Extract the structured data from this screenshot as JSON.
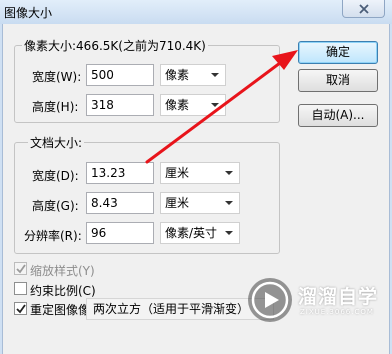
{
  "window": {
    "title": "图像大小"
  },
  "pixel_dimensions": {
    "legend": "像素大小:466.5K(之前为710.4K)",
    "width_label": "宽度(W):",
    "width_value": "500",
    "width_unit": "像素",
    "height_label": "高度(H):",
    "height_value": "318",
    "height_unit": "像素"
  },
  "document_size": {
    "legend": "文档大小:",
    "width_label": "宽度(D):",
    "width_value": "13.23",
    "width_unit": "厘米",
    "height_label": "高度(G):",
    "height_value": "8.43",
    "height_unit": "厘米",
    "resolution_label": "分辨率(R):",
    "resolution_value": "96",
    "resolution_unit": "像素/英寸"
  },
  "buttons": {
    "ok": "确定",
    "cancel": "取消",
    "auto": "自动(A)..."
  },
  "options": {
    "scale_styles": {
      "label": "缩放样式(Y)",
      "checked": true,
      "disabled": true
    },
    "constrain_proportions": {
      "label": "约束比例(C)",
      "checked": false
    },
    "resample": {
      "label": "重定图像像素(I):",
      "checked": true,
      "method": "两次立方（适用于平滑渐变）"
    }
  },
  "watermark": {
    "brand": "溜溜自学",
    "url": "ZIXUE.3066.COM"
  },
  "colors": {
    "arrow": "#e8141b",
    "title_bar": "#c9dcf1",
    "dialog_bg": "#f0f0f0"
  }
}
